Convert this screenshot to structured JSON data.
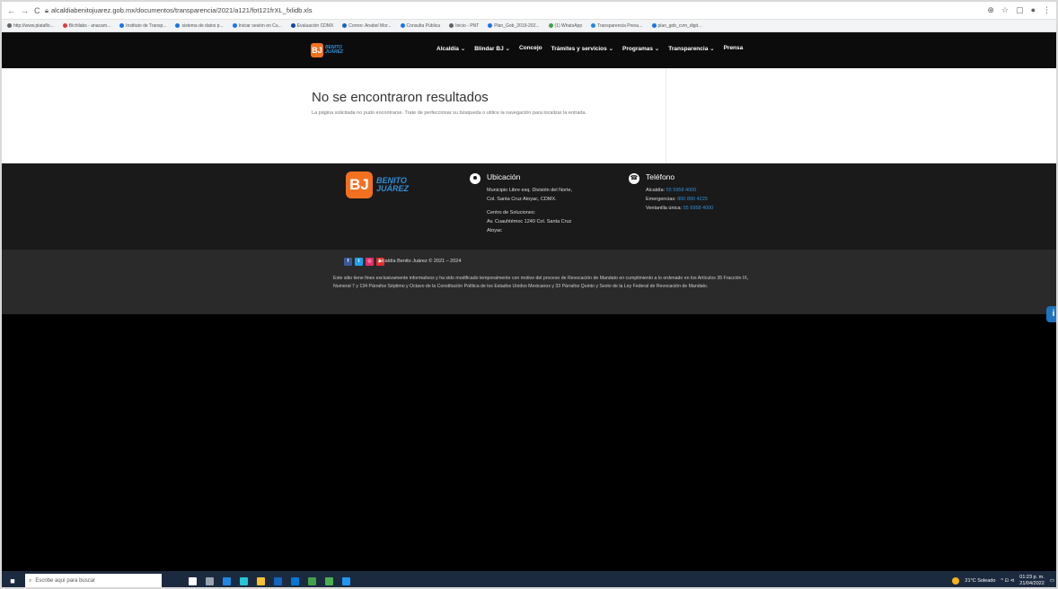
{
  "browser": {
    "nav_icons": [
      "←",
      "→",
      "C"
    ],
    "url": "alcaldiabenitojuarez.gob.mx/documentos/transparencia/2021/a121/fot121frXL_fxlidb.xls",
    "tool_icons": [
      "⊕",
      "☆",
      "▢",
      "●",
      "⋮"
    ],
    "bookmarks": [
      {
        "label": "http://www.plataflo...",
        "color": "#5f6368"
      },
      {
        "label": "Bichilabs - anacam...",
        "color": "#e53935"
      },
      {
        "label": "Instituto de Transp...",
        "color": "#1a73e8"
      },
      {
        "label": "sistema de datos p...",
        "color": "#1a73e8"
      },
      {
        "label": "Iniciar sesión en Cu...",
        "color": "#1a73e8"
      },
      {
        "label": "Evaluación CDMX",
        "color": "#0d47a1"
      },
      {
        "label": "Correo: Anabel Mor...",
        "color": "#1565c0"
      },
      {
        "label": "Consulta Pública",
        "color": "#1a73e8"
      },
      {
        "label": "Inicio - PNT",
        "color": "#5f6368"
      },
      {
        "label": "Plan_Gob_2019-202...",
        "color": "#1a73e8"
      },
      {
        "label": "(1) WhatsApp",
        "color": "#43a047"
      },
      {
        "label": "Transparencia Presu...",
        "color": "#1e88e5"
      },
      {
        "label": "plan_gob_cvm_digit...",
        "color": "#1a73e8"
      }
    ]
  },
  "site": {
    "logo_mark": "BJ",
    "logo_text_line1": "BENITO",
    "logo_text_line2": "JUÁREZ",
    "menu": [
      "Alcaldía ⌄",
      "Blindar BJ ⌄",
      "Concejo",
      "Trámites y servicios ⌄",
      "Programas ⌄",
      "Transparencia ⌄",
      "Prensa"
    ]
  },
  "main": {
    "title": "No se encontraron resultados",
    "message": "La página solicitada no pudo encontrarse. Trate de perfeccionar su búsqueda o utilice la navegación para localizar la entrada."
  },
  "footer": {
    "location": {
      "title": "Ubicación",
      "line1": "Municipio Libre esq. División del Norte,",
      "line2": "Col. Santa Cruz Atoyac, CDMX.",
      "line3": "Centro de Soluciones:",
      "line4": "Av. Cuauhtémoc 1240 Col. Santa Cruz",
      "line5": "Atoyac"
    },
    "phone": {
      "title": "Teléfono",
      "alcaldia_label": "Alcaldía:",
      "alcaldia_value": "55 5958 4000",
      "emergencias_label": "Emergencias:",
      "emergencias_value": "800 890 4225",
      "ventanilla_label": "Ventanilla única:",
      "ventanilla_value": "55 5958 4000"
    },
    "copyright": "Alcaldía Benito Juárez © 2021 – 2024",
    "legal": "Este sitio tiene fines exclusivamente informativos y ha sido modificado temporalmente con motivo del proceso de Revocación de Mandato en cumplimiento a lo ordenado en los Artículos 35 Fracción IX, Numeral 7 y 134 Párrafos Séptimo y Octavo de la Constitución Política de los Estados Unidos Mexicanos y 33 Párrafos Quinto y Sexto de la Ley Federal de Revocación de Mandato.",
    "social": [
      {
        "name": "facebook",
        "glyph": "f",
        "color": "#3b5998"
      },
      {
        "name": "twitter",
        "glyph": "t",
        "color": "#1da1f2"
      },
      {
        "name": "instagram",
        "glyph": "◎",
        "color": "#e1306c"
      },
      {
        "name": "youtube",
        "glyph": "▶",
        "color": "#e52d27"
      }
    ]
  },
  "accessibility_glyph": "i",
  "taskbar": {
    "start_glyph": "■",
    "search_placeholder": "Escribe aquí para buscar",
    "app_colors": [
      "#ffffff",
      "#9aa5b1",
      "#1e88e5",
      "#26c6da",
      "#fbc02d",
      "#1565c0",
      "#0078d4",
      "#43a047",
      "#4caf50",
      "#2196f3"
    ],
    "weather": "21°C Soleado",
    "tray_icons": "^ ⊡ ⊲",
    "time": "01:23 p. m.",
    "date": "21/04/2022"
  }
}
